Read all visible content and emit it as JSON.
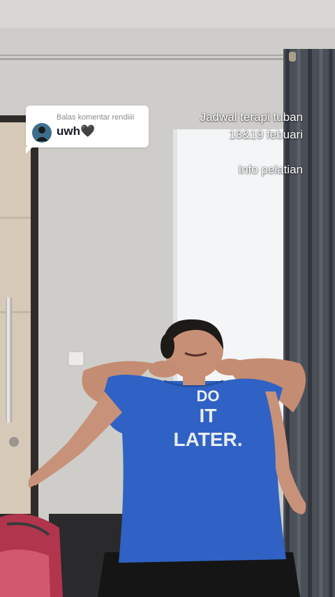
{
  "reply_card": {
    "label": "Balas komentar rendiiii",
    "comment": "uwh🖤"
  },
  "caption": {
    "line1": "Jadwal terapi tuban",
    "line2": "18&19 febuari",
    "line3": "Info pelatian"
  },
  "shirt_text": {
    "line1": "DO",
    "line2": "IT",
    "line3": "LATER."
  },
  "colors": {
    "wall": "#cfcdc9",
    "window": "#f3f5f6",
    "curtain": "#4b5058",
    "shirt": "#2f62c4",
    "door": "#d6c9b8",
    "card_bg": "#ffffff",
    "caption_text": "#ffffff"
  }
}
